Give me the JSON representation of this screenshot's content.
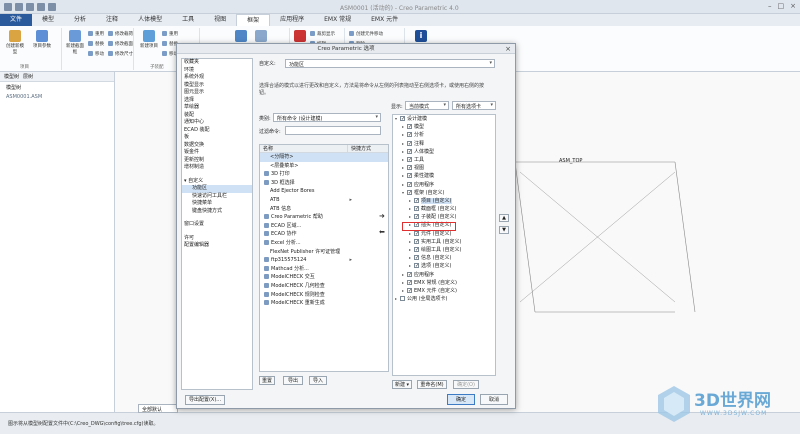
{
  "window": {
    "title": "ASM0001 (活动的) - Creo Parametric 4.0"
  },
  "tabs": [
    "文件",
    "模型",
    "分析",
    "注释",
    "人体模型",
    "工具",
    "视图",
    "框架",
    "应用程序",
    "EMX 常规",
    "EMX 元件"
  ],
  "ribbon": {
    "buttons": [
      "创建新模型",
      "项目参数",
      "新建截面框",
      "新建项目",
      "子装配"
    ],
    "small": [
      "重用",
      "替换",
      "移动",
      "修改载荷",
      "修改截面",
      "修改尺寸",
      "重用",
      "替换",
      "移动",
      "裁剪显示",
      "编辑",
      "创建元件移动",
      "删除"
    ],
    "groups": [
      "项目",
      "子装配"
    ]
  },
  "left_pane": {
    "tabs": [
      "模型树",
      "层树"
    ],
    "header": "模型树",
    "part": "ASM0001.ASM"
  },
  "graphics": {
    "datum_label": "ASM_TOP"
  },
  "status": {
    "message": "图示将从模型树配置文件中(C:\\Creo_DWG\\config\\tree.cfg)读取。",
    "filter": "全部默认"
  },
  "watermark": {
    "main": "3D世界网",
    "sub": "WWW.3DSJW.COM"
  },
  "dialog": {
    "title": "Creo Parametric 选项",
    "categories": {
      "top": [
        "收藏夹",
        "环境",
        "系统外观",
        "模型显示",
        "图元显示",
        "选择",
        "草绘器",
        "装配",
        "通知中心",
        "ECAD 装配",
        "板",
        "数据交换",
        "钣金件",
        "更新控制",
        "增材制造"
      ],
      "customize_parent": "自定义",
      "customize_children": [
        "功能区",
        "快速访问工具栏",
        "快捷菜单",
        "键盘快捷方式"
      ],
      "bottom_1": [
        "窗口设置"
      ],
      "bottom_2": [
        "许可",
        "配置编辑器"
      ]
    },
    "export_button": "导出配置(X)...",
    "customize_label": "自定义:",
    "customize_value": "功能区",
    "description": "选择合适的模式以进行更改和自定义，方法是将命令从左侧的列表拖动至右侧选项卡，或使用右侧的按钮。",
    "category_label": "类别:",
    "category_value": "所有命令 (设计建模)",
    "filter_label": "过滤命令:",
    "display_label": "显示:",
    "display_value1": "当前模式",
    "display_value2": "所有选项卡",
    "cmd_header_name": "名称",
    "cmd_header_shortcut": "快捷方式",
    "commands": [
      {
        "label": "<分隔符>",
        "icon": false,
        "sel": true
      },
      {
        "label": "<层叠菜单>",
        "icon": false
      },
      {
        "label": "3D 打印",
        "icon": true
      },
      {
        "label": "3D 框选择",
        "icon": true
      },
      {
        "label": "Add Ejector Bores",
        "icon": false
      },
      {
        "label": "ATB",
        "icon": false,
        "more": true
      },
      {
        "label": "ATB 信息",
        "icon": false
      },
      {
        "label": "Creo Parametric 帮助",
        "icon": true
      },
      {
        "label": "ECAD 区域...",
        "icon": true
      },
      {
        "label": "ECAD 协作",
        "icon": true
      },
      {
        "label": "Excel 分析...",
        "icon": true
      },
      {
        "label": "FlexNet Publisher 许可证管理",
        "icon": false
      },
      {
        "label": "ftp315575124",
        "icon": true,
        "more": true
      },
      {
        "label": "Mathcad 分析...",
        "icon": true
      },
      {
        "label": "ModelCHECK 交互",
        "icon": true
      },
      {
        "label": "ModelCHECK 几何检查",
        "icon": true
      },
      {
        "label": "ModelCHECK 规则检查",
        "icon": true
      },
      {
        "label": "ModelCHECK 重新生成",
        "icon": true
      }
    ],
    "cmd_buttons": [
      "重置",
      "导出",
      "导入"
    ],
    "ribbon_tree": [
      {
        "label": "设计建模",
        "level": 0,
        "toggle": "▾",
        "checked": true
      },
      {
        "label": "模型",
        "level": 1,
        "toggle": "▸",
        "checked": true
      },
      {
        "label": "分析",
        "level": 1,
        "toggle": "▸",
        "checked": true
      },
      {
        "label": "注释",
        "level": 1,
        "toggle": "▸",
        "checked": true
      },
      {
        "label": "人体模型",
        "level": 1,
        "toggle": "▸",
        "checked": true
      },
      {
        "label": "工具",
        "level": 1,
        "toggle": "▸",
        "checked": true
      },
      {
        "label": "视图",
        "level": 1,
        "toggle": "▸",
        "checked": true
      },
      {
        "label": "柔性建模",
        "level": 1,
        "toggle": "▸",
        "checked": true
      },
      {
        "label": "应用程序",
        "level": 1,
        "toggle": "▸",
        "checked": true
      },
      {
        "label": "框架 (自定义)",
        "level": 1,
        "toggle": "▾",
        "checked": true
      },
      {
        "label": "项目 (自定义)",
        "level": 2,
        "toggle": "▸",
        "checked": true,
        "sel": true
      },
      {
        "label": "截面框 (自定义)",
        "level": 2,
        "toggle": "▸",
        "checked": true
      },
      {
        "label": "子装配 (自定义)",
        "level": 2,
        "toggle": "▸",
        "checked": true
      },
      {
        "label": "插头 (自定义)",
        "level": 2,
        "toggle": "▸",
        "checked": true
      },
      {
        "label": "元件 (自定义)",
        "level": 2,
        "toggle": "▸",
        "checked": true
      },
      {
        "label": "实用工具 (自定义)",
        "level": 2,
        "toggle": "▸",
        "checked": true
      },
      {
        "label": "绘图工具 (自定义)",
        "level": 2,
        "toggle": "▸",
        "checked": true
      },
      {
        "label": "信息 (自定义)",
        "level": 2,
        "toggle": "▸",
        "checked": true
      },
      {
        "label": "选项 (自定义)",
        "level": 2,
        "toggle": "▸",
        "checked": true
      },
      {
        "label": "应用程序",
        "level": 1,
        "toggle": "▸",
        "checked": true
      },
      {
        "label": "EMX 常规 (自定义)",
        "level": 1,
        "toggle": "▸",
        "checked": true
      },
      {
        "label": "EMX 元件 (自定义)",
        "level": 1,
        "toggle": "▸",
        "checked": true
      },
      {
        "label": "公用 (全局选项卡)",
        "level": 0,
        "toggle": "▸",
        "checked": false
      }
    ],
    "tree_buttons": [
      "新建",
      "重命名(M)",
      "确定(O)"
    ],
    "ok": "确定",
    "cancel": "取消"
  }
}
